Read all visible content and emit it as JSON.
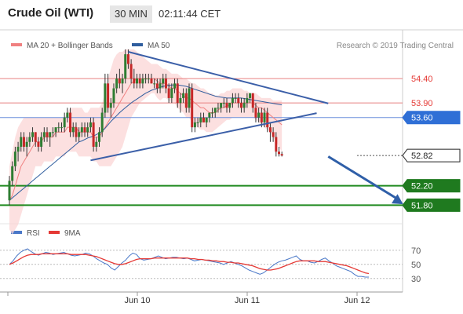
{
  "header": {
    "instrument": "Crude Oil (WTI)",
    "timeframe": "30 MIN",
    "time": "02:11:44 CET"
  },
  "legend": {
    "items": [
      {
        "label": "MA 20 + Bollinger Bands",
        "color": "#f08080"
      },
      {
        "label": "MA 50",
        "color": "#2f5d9e"
      }
    ],
    "credit": "Research © 2019 Trading Central"
  },
  "chart_data": [
    {
      "type": "candlestick",
      "title": "Crude Oil (WTI)",
      "ylim": [
        51.5,
        54.95
      ],
      "x_ticks": [
        "Jun 10",
        "Jun 11",
        "Jun 12"
      ],
      "price_labels": [
        {
          "value": 54.4,
          "text": "54.40",
          "style": "resistance-text",
          "color": "#e53935"
        },
        {
          "value": 53.9,
          "text": "53.90",
          "style": "resistance-text",
          "color": "#e53935"
        },
        {
          "value": 53.6,
          "text": "53.60",
          "style": "current-blue",
          "color": "#2f6fd6"
        },
        {
          "value": 52.82,
          "text": "52.82",
          "style": "last-price",
          "color": "#222222"
        },
        {
          "value": 52.2,
          "text": "52.20",
          "style": "target-green",
          "color": "#1f7a1f"
        },
        {
          "value": 51.8,
          "text": "51.80",
          "style": "target-green",
          "color": "#1f7a1f"
        }
      ],
      "ohlc": [
        [
          51.9,
          52.4,
          51.8,
          52.3
        ],
        [
          52.3,
          52.7,
          52.2,
          52.6
        ],
        [
          52.6,
          53.0,
          52.5,
          52.9
        ],
        [
          52.9,
          53.1,
          52.7,
          53.0
        ],
        [
          53.0,
          53.3,
          52.9,
          53.2
        ],
        [
          53.2,
          53.3,
          52.9,
          53.0
        ],
        [
          53.0,
          53.2,
          52.8,
          53.1
        ],
        [
          53.1,
          53.3,
          53.0,
          53.2
        ],
        [
          53.2,
          53.4,
          53.1,
          53.3
        ],
        [
          53.3,
          53.3,
          53.0,
          53.1
        ],
        [
          53.1,
          53.2,
          52.9,
          53.0
        ],
        [
          53.0,
          53.3,
          52.9,
          53.2
        ],
        [
          53.2,
          53.4,
          53.1,
          53.3
        ],
        [
          53.3,
          53.4,
          53.1,
          53.2
        ],
        [
          53.2,
          53.3,
          53.0,
          53.3
        ],
        [
          53.3,
          53.4,
          53.2,
          53.3
        ],
        [
          53.3,
          53.4,
          53.2,
          53.4
        ],
        [
          53.4,
          53.5,
          53.3,
          53.4
        ],
        [
          53.4,
          53.5,
          53.3,
          53.4
        ],
        [
          53.4,
          53.7,
          53.3,
          53.6
        ],
        [
          53.6,
          53.8,
          53.5,
          53.7
        ],
        [
          53.7,
          53.8,
          53.2,
          53.3
        ],
        [
          53.3,
          53.5,
          53.2,
          53.4
        ],
        [
          53.4,
          53.5,
          53.1,
          53.2
        ],
        [
          53.2,
          53.4,
          53.1,
          53.3
        ],
        [
          53.3,
          53.5,
          53.2,
          53.4
        ],
        [
          53.4,
          53.5,
          53.2,
          53.3
        ],
        [
          53.3,
          53.5,
          53.2,
          53.4
        ],
        [
          53.4,
          53.6,
          53.3,
          53.5
        ],
        [
          53.5,
          53.6,
          52.9,
          53.0
        ],
        [
          53.0,
          53.2,
          52.9,
          53.1
        ],
        [
          53.1,
          53.4,
          53.0,
          53.3
        ],
        [
          53.3,
          53.8,
          53.2,
          53.7
        ],
        [
          53.7,
          54.5,
          53.6,
          54.3
        ],
        [
          54.3,
          54.5,
          53.7,
          53.8
        ],
        [
          53.8,
          54.0,
          53.6,
          53.9
        ],
        [
          53.9,
          54.3,
          53.8,
          54.2
        ],
        [
          54.2,
          54.5,
          54.1,
          54.4
        ],
        [
          54.4,
          54.6,
          54.2,
          54.3
        ],
        [
          54.3,
          54.5,
          54.1,
          54.4
        ],
        [
          54.4,
          55.0,
          54.3,
          54.9
        ],
        [
          54.9,
          55.0,
          54.6,
          54.7
        ],
        [
          54.7,
          54.8,
          54.3,
          54.4
        ],
        [
          54.4,
          54.6,
          54.2,
          54.3
        ],
        [
          54.3,
          54.5,
          54.2,
          54.4
        ],
        [
          54.4,
          54.5,
          54.2,
          54.3
        ],
        [
          54.3,
          54.5,
          54.2,
          54.4
        ],
        [
          54.4,
          54.5,
          54.3,
          54.4
        ],
        [
          54.4,
          54.5,
          54.3,
          54.4
        ],
        [
          54.4,
          54.5,
          54.3,
          54.3
        ],
        [
          54.3,
          54.4,
          54.2,
          54.3
        ],
        [
          54.3,
          54.4,
          54.1,
          54.2
        ],
        [
          54.2,
          54.4,
          54.1,
          54.3
        ],
        [
          54.3,
          54.5,
          54.2,
          54.4
        ],
        [
          54.4,
          54.5,
          54.1,
          54.2
        ],
        [
          54.2,
          54.3,
          53.9,
          54.0
        ],
        [
          54.0,
          54.3,
          53.9,
          54.2
        ],
        [
          54.2,
          54.4,
          54.1,
          54.3
        ],
        [
          54.3,
          54.4,
          53.8,
          53.9
        ],
        [
          53.9,
          54.1,
          53.7,
          54.0
        ],
        [
          54.0,
          54.2,
          53.9,
          54.1
        ],
        [
          54.1,
          54.2,
          53.7,
          53.8
        ],
        [
          53.8,
          54.3,
          53.7,
          54.2
        ],
        [
          54.2,
          54.3,
          53.3,
          53.4
        ],
        [
          53.4,
          53.6,
          53.3,
          53.5
        ],
        [
          53.5,
          53.6,
          53.4,
          53.5
        ],
        [
          53.5,
          53.7,
          53.4,
          53.6
        ],
        [
          53.6,
          53.7,
          53.5,
          53.5
        ],
        [
          53.5,
          53.6,
          53.4,
          53.6
        ],
        [
          53.6,
          53.7,
          53.5,
          53.7
        ],
        [
          53.7,
          53.8,
          53.6,
          53.7
        ],
        [
          53.7,
          53.8,
          53.6,
          53.8
        ],
        [
          53.8,
          53.9,
          53.7,
          53.8
        ],
        [
          53.8,
          53.9,
          53.7,
          53.9
        ],
        [
          53.9,
          54.0,
          53.8,
          53.9
        ],
        [
          53.9,
          54.0,
          53.7,
          53.8
        ],
        [
          53.8,
          53.9,
          53.7,
          53.9
        ],
        [
          53.9,
          54.1,
          53.8,
          54.0
        ],
        [
          54.0,
          54.1,
          53.9,
          54.0
        ],
        [
          54.0,
          54.1,
          53.8,
          53.9
        ],
        [
          53.9,
          54.0,
          53.7,
          53.8
        ],
        [
          53.8,
          54.0,
          53.7,
          53.9
        ],
        [
          53.9,
          54.1,
          53.8,
          54.0
        ],
        [
          54.0,
          54.1,
          53.9,
          54.1
        ],
        [
          54.1,
          54.1,
          53.7,
          53.8
        ],
        [
          53.8,
          53.9,
          53.5,
          53.6
        ],
        [
          53.6,
          53.8,
          53.5,
          53.7
        ],
        [
          53.7,
          53.8,
          53.4,
          53.5
        ],
        [
          53.5,
          53.8,
          53.4,
          53.7
        ],
        [
          53.7,
          53.8,
          53.3,
          53.4
        ],
        [
          53.4,
          53.5,
          53.1,
          53.3
        ],
        [
          53.3,
          53.4,
          53.1,
          53.2
        ],
        [
          53.2,
          53.3,
          52.8,
          52.9
        ],
        [
          52.9,
          53.0,
          52.8,
          52.85
        ],
        [
          52.85,
          52.9,
          52.8,
          52.82
        ]
      ],
      "ma20": [
        51.9,
        52.0,
        52.2,
        52.4,
        52.6,
        52.7,
        52.8,
        52.9,
        53.0,
        53.1,
        53.1,
        53.1,
        53.2,
        53.2,
        53.2,
        53.2,
        53.3,
        53.3,
        53.3,
        53.3,
        53.4,
        53.4,
        53.4,
        53.4,
        53.3,
        53.3,
        53.3,
        53.3,
        53.3,
        53.2,
        53.2,
        53.2,
        53.3,
        53.4,
        53.5,
        53.6,
        53.7,
        53.8,
        53.9,
        54.0,
        54.1,
        54.2,
        54.3,
        54.35,
        54.4,
        54.4,
        54.4,
        54.4,
        54.4,
        54.4,
        54.4,
        54.35,
        54.3,
        54.3,
        54.3,
        54.25,
        54.2,
        54.2,
        54.15,
        54.1,
        54.05,
        54.0,
        54.0,
        53.95,
        53.9,
        53.85,
        53.8,
        53.8,
        53.75,
        53.7,
        53.7,
        53.7,
        53.75,
        53.8,
        53.8,
        53.85,
        53.85,
        53.9,
        53.9,
        53.9,
        53.9,
        53.9,
        53.9,
        53.9,
        53.9,
        53.85,
        53.8,
        53.8,
        53.75,
        53.7,
        53.65,
        53.6,
        53.55,
        53.5,
        53.45
      ],
      "bb_upper": [
        52.6,
        52.9,
        53.2,
        53.4,
        53.5,
        53.6,
        53.6,
        53.6,
        53.6,
        53.6,
        53.6,
        53.6,
        53.6,
        53.6,
        53.6,
        53.6,
        53.6,
        53.6,
        53.6,
        53.6,
        53.7,
        53.8,
        53.8,
        53.8,
        53.8,
        53.8,
        53.7,
        53.7,
        53.8,
        53.8,
        53.8,
        53.8,
        53.9,
        54.1,
        54.4,
        54.6,
        54.8,
        54.9,
        54.95,
        54.95,
        55.0,
        55.0,
        55.0,
        55.0,
        54.95,
        54.9,
        54.85,
        54.8,
        54.75,
        54.7,
        54.7,
        54.7,
        54.65,
        54.6,
        54.6,
        54.55,
        54.5,
        54.5,
        54.5,
        54.45,
        54.4,
        54.4,
        54.35,
        54.3,
        54.3,
        54.25,
        54.2,
        54.2,
        54.15,
        54.1,
        54.1,
        54.05,
        54.05,
        54.1,
        54.1,
        54.15,
        54.15,
        54.2,
        54.2,
        54.2,
        54.2,
        54.15,
        54.15,
        54.1,
        54.1,
        54.1,
        54.05,
        54.0,
        54.0,
        54.0,
        54.0,
        53.95,
        53.95,
        53.95,
        53.95
      ],
      "bb_lower": [
        51.3,
        51.2,
        51.3,
        51.4,
        51.6,
        51.8,
        52.0,
        52.2,
        52.4,
        52.6,
        52.6,
        52.6,
        52.7,
        52.7,
        52.7,
        52.7,
        52.8,
        52.8,
        52.8,
        52.8,
        52.9,
        52.9,
        52.9,
        52.9,
        52.8,
        52.8,
        52.8,
        52.8,
        52.8,
        52.7,
        52.7,
        52.6,
        52.6,
        52.6,
        52.6,
        52.6,
        52.7,
        52.8,
        52.9,
        53.0,
        53.2,
        53.4,
        53.6,
        53.7,
        53.8,
        53.9,
        53.95,
        54.0,
        54.05,
        54.1,
        54.1,
        54.0,
        53.95,
        54.0,
        54.0,
        53.95,
        53.9,
        53.9,
        53.8,
        53.75,
        53.7,
        53.6,
        53.6,
        53.5,
        53.45,
        53.4,
        53.35,
        53.35,
        53.3,
        53.3,
        53.3,
        53.35,
        53.4,
        53.45,
        53.5,
        53.55,
        53.55,
        53.6,
        53.6,
        53.6,
        53.6,
        53.6,
        53.6,
        53.6,
        53.6,
        53.55,
        53.5,
        53.45,
        53.4,
        53.35,
        53.3,
        53.2,
        53.1,
        53.0,
        52.9
      ],
      "ma50": [
        51.9,
        51.95,
        52.0,
        52.05,
        52.1,
        52.15,
        52.2,
        52.25,
        52.3,
        52.35,
        52.4,
        52.45,
        52.5,
        52.55,
        52.6,
        52.65,
        52.7,
        52.75,
        52.8,
        52.85,
        52.9,
        52.95,
        53.0,
        53.05,
        53.1,
        53.12,
        53.15,
        53.18,
        53.2,
        53.22,
        53.25,
        53.28,
        53.32,
        53.38,
        53.45,
        53.52,
        53.58,
        53.64,
        53.7,
        53.75,
        53.8,
        53.85,
        53.9,
        53.94,
        53.98,
        54.02,
        54.06,
        54.1,
        54.13,
        54.16,
        54.18,
        54.2,
        54.22,
        54.24,
        54.25,
        54.26,
        54.27,
        54.27,
        54.27,
        54.26,
        54.25,
        54.24,
        54.22,
        54.2,
        54.18,
        54.16,
        54.14,
        54.12,
        54.1,
        54.08,
        54.06,
        54.04,
        54.03,
        54.02,
        54.01,
        54.0,
        54.0,
        54.0,
        54.0,
        54.0,
        54.0,
        53.99,
        53.98,
        53.97,
        53.96,
        53.95,
        53.94,
        53.93,
        53.92,
        53.91,
        53.9,
        53.89,
        53.88,
        53.87,
        53.86
      ],
      "trend_lines": [
        {
          "name": "upper-triangle-line",
          "points": [
            [
              41,
              54.95
            ],
            [
              110,
              53.89
            ]
          ]
        },
        {
          "name": "lower-triangle-line",
          "points": [
            [
              28,
              52.72
            ],
            [
              106,
              53.69
            ]
          ]
        }
      ],
      "projection_arrow": {
        "from": [
          110,
          52.8
        ],
        "to": [
          125,
          51.82
        ]
      },
      "bar_count_total": 125
    },
    {
      "type": "line",
      "title": "RSI",
      "ylim": [
        22,
        82
      ],
      "y_ticks": [
        30,
        50,
        70
      ],
      "series": [
        {
          "name": "RSI",
          "color": "#4a78c8",
          "values": [
            50,
            55,
            62,
            67,
            70,
            72,
            68,
            65,
            63,
            65,
            67,
            66,
            64,
            65,
            66,
            67,
            65,
            63,
            62,
            63,
            64,
            66,
            65,
            62,
            58,
            55,
            52,
            50,
            45,
            42,
            47,
            52,
            56,
            62,
            66,
            64,
            58,
            56,
            57,
            58,
            60,
            62,
            60,
            58,
            59,
            60,
            60,
            59,
            58,
            59,
            57,
            55,
            56,
            57,
            56,
            55,
            54,
            53,
            52,
            50,
            52,
            54,
            52,
            50,
            48,
            45,
            42,
            40,
            38,
            36,
            38,
            42,
            46,
            50,
            53,
            55,
            56,
            58,
            60,
            62,
            57,
            55,
            55,
            53,
            52,
            54,
            57,
            59,
            55,
            52,
            48,
            46,
            44,
            42,
            40,
            36,
            33,
            33,
            32,
            32
          ]
        },
        {
          "name": "9MA",
          "color": "#e53935",
          "values": [
            50,
            52,
            55,
            58,
            61,
            63,
            64,
            64,
            64,
            65,
            65,
            65,
            65,
            65,
            65,
            65,
            65,
            64,
            64,
            64,
            64,
            64,
            63,
            62,
            61,
            59,
            57,
            55,
            53,
            51,
            50,
            50,
            51,
            53,
            55,
            57,
            58,
            58,
            58,
            58,
            59,
            59,
            59,
            59,
            59,
            59,
            59,
            59,
            59,
            59,
            58,
            58,
            57,
            57,
            56,
            56,
            55,
            55,
            54,
            54,
            53,
            53,
            52,
            52,
            51,
            50,
            49,
            48,
            46,
            44,
            43,
            42,
            42,
            43,
            44,
            46,
            48,
            50,
            52,
            54,
            55,
            55,
            55,
            55,
            55,
            54,
            54,
            54,
            53,
            52,
            51,
            50,
            49,
            48,
            46,
            44,
            42,
            40,
            38,
            37
          ]
        }
      ]
    }
  ]
}
